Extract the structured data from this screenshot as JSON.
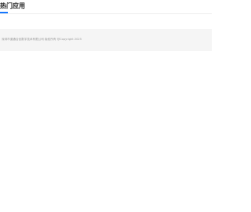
{
  "section": {
    "title": "热门应用"
  },
  "footer": {
    "copyright": "深圳市道通合创数字技术有限公司 版权所有 @Copyright 2025"
  },
  "colors": {
    "accent": "#1677ff",
    "footer_bg": "#f5f5f5"
  }
}
